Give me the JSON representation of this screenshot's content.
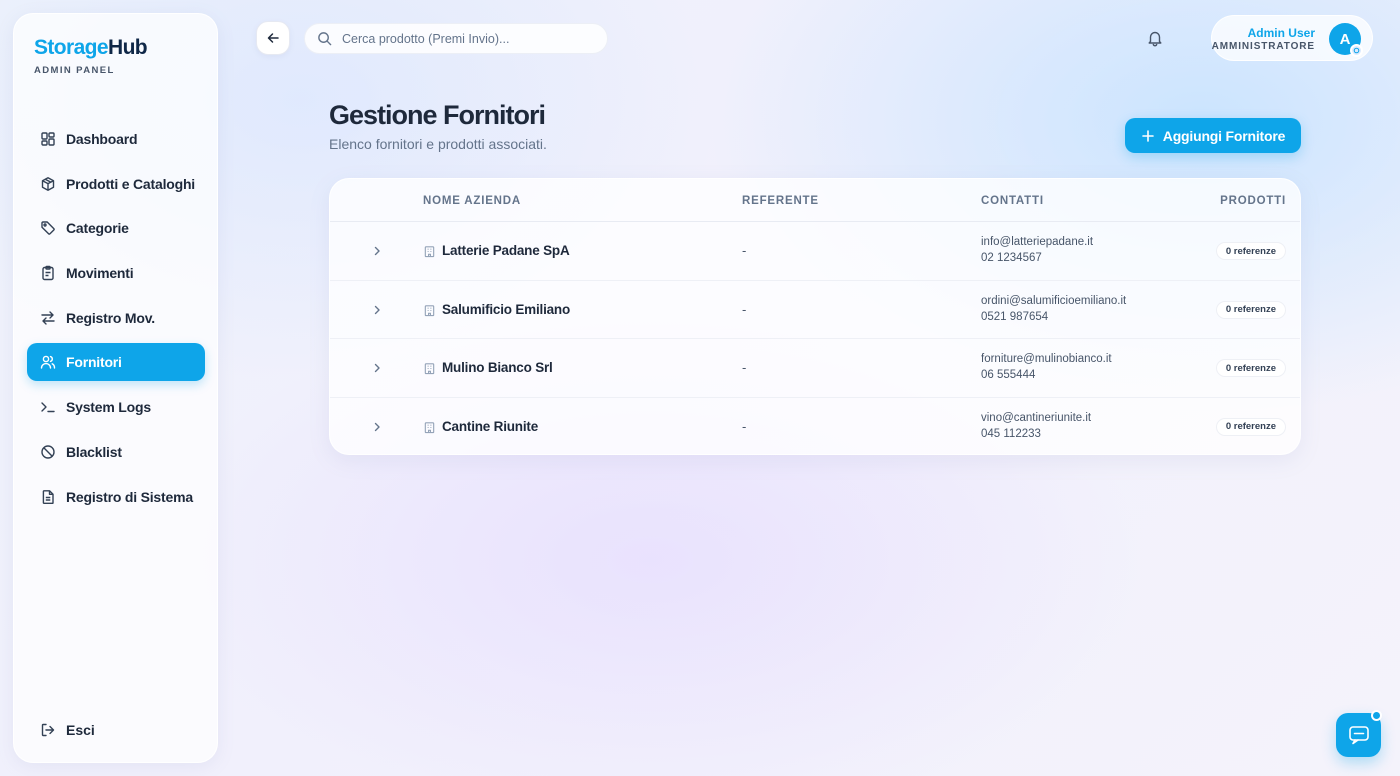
{
  "brand": {
    "name_part1": "Storage",
    "name_part2": "Hub",
    "subtitle": "ADMIN PANEL"
  },
  "sidebar": {
    "items": [
      {
        "label": "Dashboard",
        "icon": "grid-icon",
        "active": false
      },
      {
        "label": "Prodotti e Cataloghi",
        "icon": "box-icon",
        "active": false
      },
      {
        "label": "Categorie",
        "icon": "tag-icon",
        "active": false
      },
      {
        "label": "Movimenti",
        "icon": "clipboard-icon",
        "active": false
      },
      {
        "label": "Registro Mov.",
        "icon": "arrows-swap-icon",
        "active": false
      },
      {
        "label": "Fornitori",
        "icon": "users-icon",
        "active": true
      },
      {
        "label": "System Logs",
        "icon": "terminal-icon",
        "active": false
      },
      {
        "label": "Blacklist",
        "icon": "ban-icon",
        "active": false
      },
      {
        "label": "Registro di Sistema",
        "icon": "document-icon",
        "active": false
      }
    ],
    "logout_label": "Esci"
  },
  "topbar": {
    "search_placeholder": "Cerca prodotto (Premi Invio)...",
    "user_name": "Admin User",
    "user_role": "AMMINISTRATORE",
    "avatar_initial": "A"
  },
  "page": {
    "title": "Gestione Fornitori",
    "subtitle": "Elenco fornitori e prodotti associati.",
    "add_button_label": "Aggiungi Fornitore"
  },
  "table": {
    "headers": {
      "name": "NOME AZIENDA",
      "ref": "REFERENTE",
      "contacts": "CONTATTI",
      "products": "PRODOTTI"
    },
    "rows": [
      {
        "name": "Latterie Padane SpA",
        "ref": "-",
        "email": "info@latteriepadane.it",
        "phone": "02 1234567",
        "products": "0 referenze"
      },
      {
        "name": "Salumificio Emiliano",
        "ref": "-",
        "email": "ordini@salumificioemiliano.it",
        "phone": "0521 987654",
        "products": "0 referenze"
      },
      {
        "name": "Mulino Bianco Srl",
        "ref": "-",
        "email": "forniture@mulinobianco.it",
        "phone": "06 555444",
        "products": "0 referenze"
      },
      {
        "name": "Cantine Riunite",
        "ref": "-",
        "email": "vino@cantineriunite.it",
        "phone": "045 112233",
        "products": "0 referenze"
      }
    ]
  },
  "colors": {
    "accent": "#0ea5e9",
    "brand_dark": "#0f2747",
    "text": "#1e293b",
    "muted": "#64748b"
  }
}
